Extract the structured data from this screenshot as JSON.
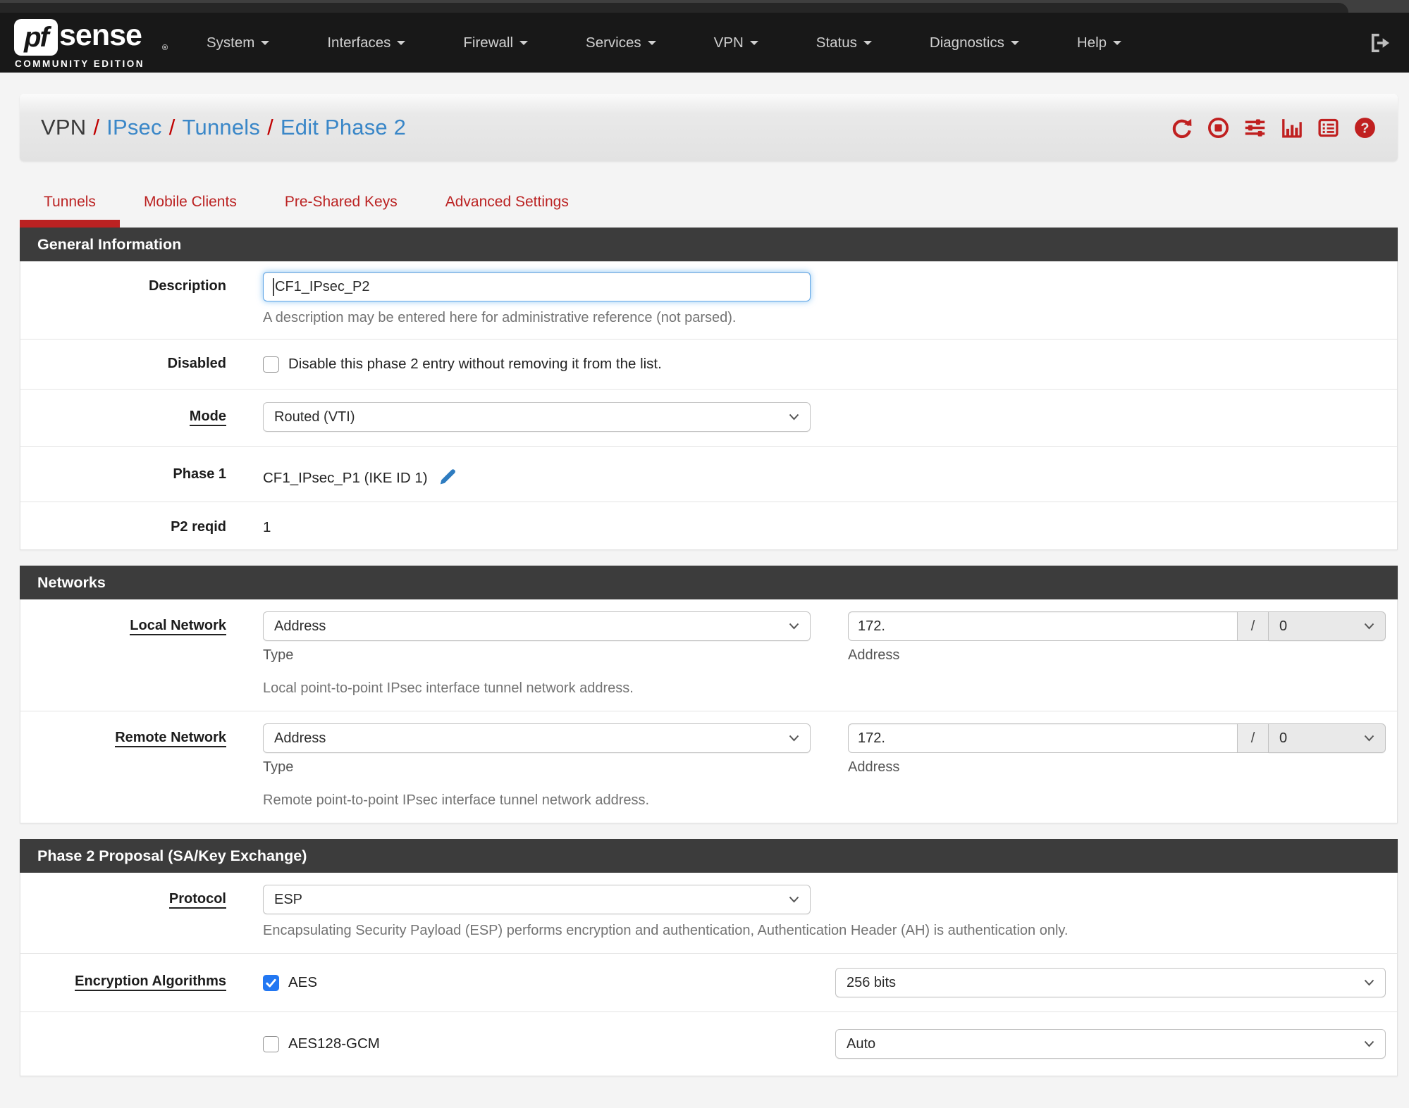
{
  "navbar": {
    "logo": {
      "pf": "pf",
      "sense": "sense",
      "reg": "®",
      "edition": "COMMUNITY EDITION"
    },
    "items": [
      {
        "label": "System"
      },
      {
        "label": "Interfaces"
      },
      {
        "label": "Firewall"
      },
      {
        "label": "Services"
      },
      {
        "label": "VPN"
      },
      {
        "label": "Status"
      },
      {
        "label": "Diagnostics"
      },
      {
        "label": "Help"
      }
    ],
    "logout_icon": "sign-out-icon"
  },
  "breadcrumb": {
    "segments": [
      {
        "label": "VPN"
      },
      {
        "label": "IPsec"
      },
      {
        "label": "Tunnels"
      },
      {
        "label": "Edit Phase 2"
      }
    ],
    "separator": "/",
    "icons": [
      "refresh-icon",
      "stop-circle-icon",
      "sliders-icon",
      "bar-chart-icon",
      "list-icon",
      "help-icon"
    ]
  },
  "tabs": [
    {
      "label": "Tunnels",
      "active": true
    },
    {
      "label": "Mobile Clients",
      "active": false
    },
    {
      "label": "Pre-Shared Keys",
      "active": false
    },
    {
      "label": "Advanced Settings",
      "active": false
    }
  ],
  "gi": {
    "title": "General Information",
    "description_label": "Description",
    "description_value": "CF1_IPsec_P2",
    "description_help": "A description may be entered here for administrative reference (not parsed).",
    "disabled_label": "Disabled",
    "disabled_text": "Disable this phase 2 entry without removing it from the list.",
    "disabled_checked": false,
    "mode_label": "Mode",
    "mode_value": "Routed (VTI)",
    "phase1_label": "Phase 1",
    "phase1_value": "CF1_IPsec_P1 (IKE ID 1)",
    "p2reqid_label": "P2 reqid",
    "p2reqid_value": "1"
  },
  "net": {
    "title": "Networks",
    "local": {
      "label": "Local Network",
      "type_value": "Address",
      "type_help": "Type",
      "addr_value": "172.",
      "addr_help": "Address",
      "slash": "/",
      "prefix_value": "0",
      "help": "Local point-to-point IPsec interface tunnel network address."
    },
    "remote": {
      "label": "Remote Network",
      "type_value": "Address",
      "type_help": "Type",
      "addr_value": "172.",
      "addr_help": "Address",
      "slash": "/",
      "prefix_value": "0",
      "help": "Remote point-to-point IPsec interface tunnel network address."
    }
  },
  "prop": {
    "title": "Phase 2 Proposal (SA/Key Exchange)",
    "protocol_label": "Protocol",
    "protocol_value": "ESP",
    "protocol_help": "Encapsulating Security Payload (ESP) performs encryption and authentication, Authentication Header (AH) is authentication only.",
    "enc_label": "Encryption Algorithms",
    "algos": [
      {
        "name": "AES",
        "checked": true,
        "keylen": "256 bits"
      },
      {
        "name": "AES128-GCM",
        "checked": false,
        "keylen": "Auto"
      }
    ]
  },
  "colors": {
    "accent_red": "#bb2222",
    "link_blue": "#3a87c8",
    "checkbox_blue": "#2277f2",
    "focus_blue": "#5fa5e6",
    "navbar_bg": "#181818",
    "panel_header_bg": "#3c3c3c"
  }
}
